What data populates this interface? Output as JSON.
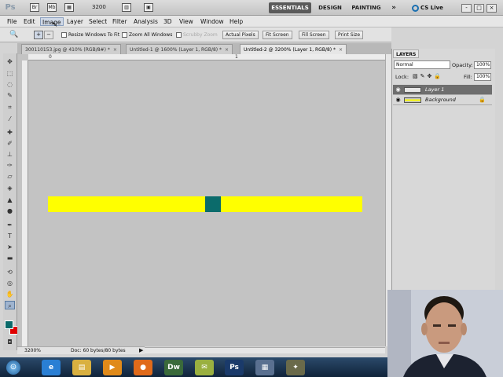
{
  "app": {
    "logo": "Ps",
    "zoom_value": "3200",
    "workspaces": [
      "ESSENTIALS",
      "DESIGN",
      "PAINTING"
    ],
    "more_workspaces": "»",
    "cs_live": "CS Live",
    "window_controls": [
      "-",
      "□",
      "×"
    ]
  },
  "menu": {
    "items": [
      "File",
      "Edit",
      "Image",
      "Layer",
      "Select",
      "Filter",
      "Analysis",
      "3D",
      "View",
      "Window",
      "Help"
    ],
    "active": "Image"
  },
  "options": {
    "resize_windows": "Resize Windows To Fit",
    "zoom_all_windows": "Zoom All Windows",
    "scrubby_zoom": "Scrubby Zoom",
    "buttons": [
      "Actual Pixels",
      "Fit Screen",
      "Fill Screen",
      "Print Size"
    ]
  },
  "tabs": [
    {
      "label": "300110153.jpg @ 410% (RGB/8#) *",
      "close": "×"
    },
    {
      "label": "Untitled-1 @ 1600% (Layer 1, RGB/8) *",
      "close": "×"
    },
    {
      "label": "Untitled-2 @ 3200% (Layer 1, RGB/8) *",
      "close": "×"
    }
  ],
  "ruler": {
    "zero": "0",
    "one": "1"
  },
  "canvas": {
    "bar_color": "#ffff00",
    "block_color": "#0b6b6b",
    "background": "#c3c3c3"
  },
  "status": {
    "zoom": "3200%",
    "doc": "Doc: 60 bytes/80 bytes"
  },
  "layers": {
    "tab": "LAYERS",
    "blend_mode": "Normal",
    "opacity_label": "Opacity:",
    "opacity_value": "100%",
    "lock_label": "Lock:",
    "fill_label": "Fill:",
    "fill_value": "100%",
    "items": [
      {
        "name": "Layer 1",
        "selected": true
      },
      {
        "name": "Background",
        "selected": false,
        "locked": true
      }
    ]
  },
  "taskbar": {
    "start": "⊙",
    "apps": [
      {
        "name": "internet-explorer",
        "glyph": "e",
        "color": "#2a7fd4"
      },
      {
        "name": "file-explorer",
        "glyph": "▤",
        "color": "#d9b040"
      },
      {
        "name": "media-player",
        "glyph": "▶",
        "color": "#e08a1a"
      },
      {
        "name": "firefox",
        "glyph": "●",
        "color": "#e06a1a"
      },
      {
        "name": "dreamweaver",
        "glyph": "Dw",
        "color": "#3a6a3a"
      },
      {
        "name": "messenger",
        "glyph": "✉",
        "color": "#9ab040"
      },
      {
        "name": "photoshop",
        "glyph": "Ps",
        "color": "#1a3a6a"
      },
      {
        "name": "document",
        "glyph": "▦",
        "color": "#5a7090"
      },
      {
        "name": "tools",
        "glyph": "✦",
        "color": "#6a6a4a"
      }
    ]
  }
}
